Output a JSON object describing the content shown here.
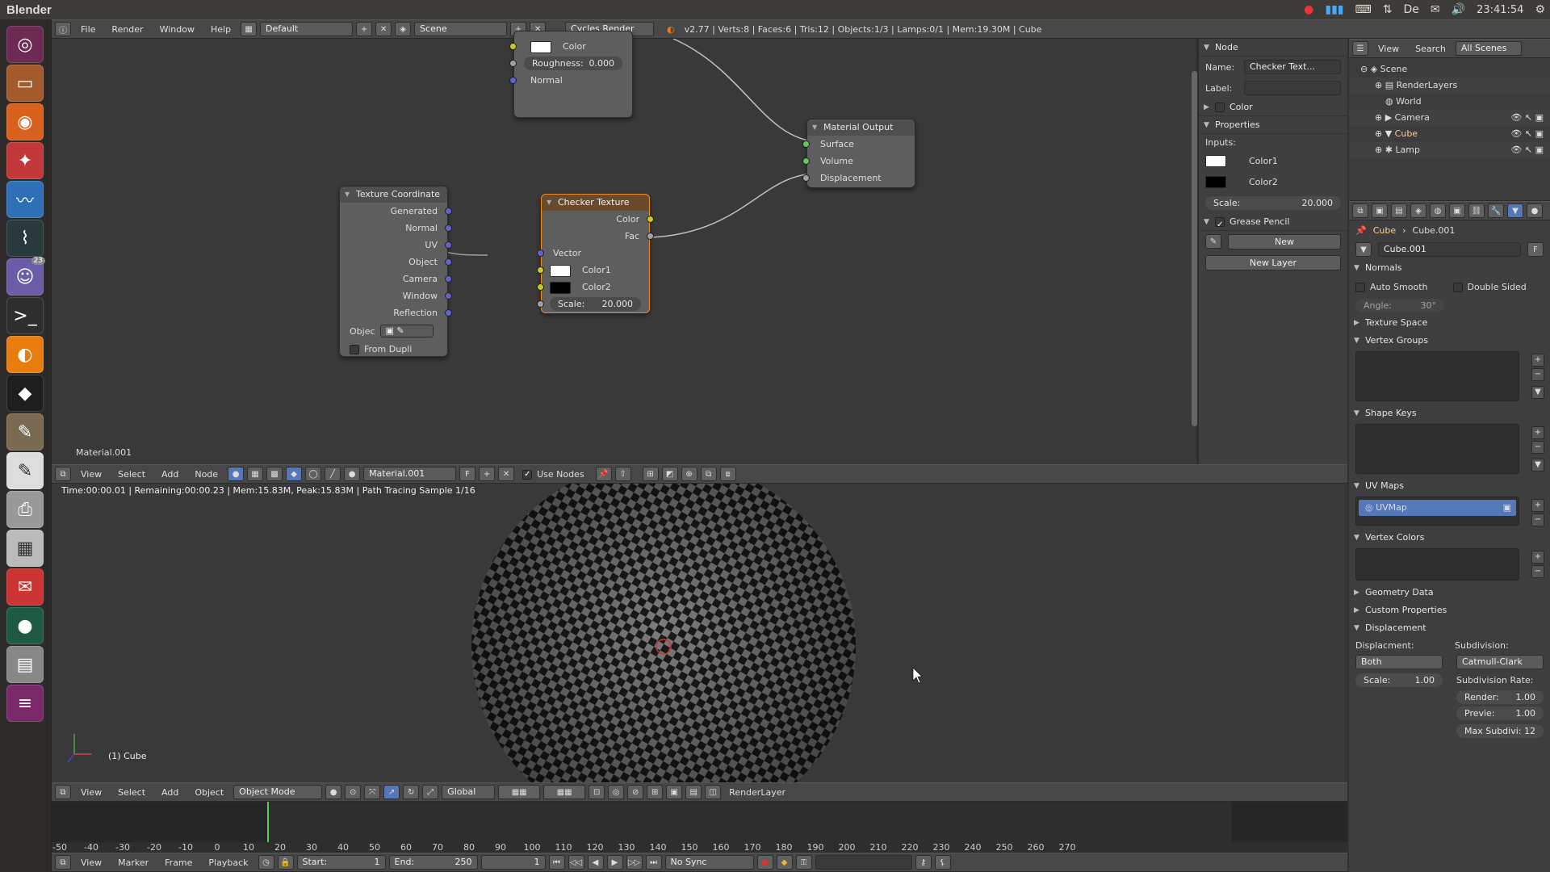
{
  "topbar": {
    "app_title": "Blender",
    "time": "23:41:54"
  },
  "launcher": {
    "badge": "23"
  },
  "info_header": {
    "menus": [
      "File",
      "Render",
      "Window",
      "Help"
    ],
    "screen_layout": "Default",
    "scene": "Scene",
    "engine": "Cycles Render",
    "stats": "v2.77 | Verts:8 | Faces:6 | Tris:12 | Objects:1/3 | Lamps:0/1 | Mem:19.30M | Cube"
  },
  "node_editor": {
    "label": "Material.001",
    "bsdf_partial": {
      "color_label": "Color",
      "roughness_label": "Roughness:",
      "roughness_value": "0.000",
      "normal_label": "Normal"
    },
    "texcoord": {
      "title": "Texture Coordinate",
      "outputs": [
        "Generated",
        "Normal",
        "UV",
        "Object",
        "Camera",
        "Window",
        "Reflection"
      ],
      "object_label": "Objec",
      "from_dupli": "From Dupli"
    },
    "checker": {
      "title": "Checker Texture",
      "out_color": "Color",
      "out_fac": "Fac",
      "vector": "Vector",
      "color1": "Color1",
      "color2": "Color2",
      "scale_label": "Scale:",
      "scale_value": "20.000"
    },
    "output": {
      "title": "Material Output",
      "surface": "Surface",
      "volume": "Volume",
      "displacement": "Displacement"
    }
  },
  "npanel": {
    "node_section": "Node",
    "name_label": "Name:",
    "name_value": "Checker Text...",
    "label_label": "Label:",
    "color_section": "Color",
    "properties_section": "Properties",
    "inputs_label": "Inputs:",
    "color1": "Color1",
    "color2": "Color2",
    "scale_label": "Scale:",
    "scale_value": "20.000",
    "grease_pencil": "Grease Pencil",
    "new_btn": "New",
    "new_layer_btn": "New Layer"
  },
  "node_header": {
    "menus": [
      "View",
      "Select",
      "Add",
      "Node"
    ],
    "material": "Material.001",
    "f_label": "F",
    "use_nodes": "Use Nodes"
  },
  "viewport": {
    "info": "Time:00:00.01 | Remaining:00:00.23 | Mem:15.83M, Peak:15.83M | Path Tracing Sample 1/16",
    "object_label": "(1) Cube"
  },
  "view3d_header": {
    "menus": [
      "View",
      "Select",
      "Add",
      "Object"
    ],
    "mode": "Object Mode",
    "orientation": "Global",
    "render_layer": "RenderLayer"
  },
  "outliner": {
    "menus": [
      "View",
      "Search"
    ],
    "filter": "All Scenes",
    "items": [
      "Scene",
      "RenderLayers",
      "World",
      "Camera",
      "Cube",
      "Lamp"
    ]
  },
  "properties": {
    "breadcrumb_obj": "Cube",
    "breadcrumb_mesh": "Cube.001",
    "mesh_name": "Cube.001",
    "f_label": "F",
    "normals": "Normals",
    "auto_smooth": "Auto Smooth",
    "double_sided": "Double Sided",
    "angle_label": "Angle:",
    "angle_value": "30°",
    "texture_space": "Texture Space",
    "vertex_groups": "Vertex Groups",
    "shape_keys": "Shape Keys",
    "uv_maps": "UV Maps",
    "uvmap_item": "UVMap",
    "vertex_colors": "Vertex Colors",
    "geometry_data": "Geometry Data",
    "custom_properties": "Custom Properties",
    "displacement": "Displacement",
    "displacement_label": "Displacment:",
    "displacement_value": "Both",
    "subdivision_label": "Subdivision:",
    "subdivision_value": "Catmull-Clark",
    "subdiv_rate_label": "Subdivision Rate:",
    "scale_label": "Scale:",
    "scale_value": "1.00",
    "render_label": "Render:",
    "render_value": "1.00",
    "preview_label": "Previe:",
    "preview_value": "1.00",
    "max_subdiv_label": "Max Subdivi:",
    "max_subdiv_value": "12"
  },
  "timeline": {
    "ticks": [
      "-50",
      "-40",
      "-30",
      "-20",
      "-10",
      "0",
      "10",
      "20",
      "30",
      "40",
      "50",
      "60",
      "70",
      "80",
      "90",
      "100",
      "110",
      "120",
      "130",
      "140",
      "150",
      "160",
      "170",
      "180",
      "190",
      "200",
      "210",
      "220",
      "230",
      "240",
      "250",
      "260",
      "270"
    ]
  },
  "timeline_header": {
    "menus": [
      "View",
      "Marker",
      "Frame",
      "Playback"
    ],
    "start_label": "Start:",
    "start_value": "1",
    "end_label": "End:",
    "end_value": "250",
    "current": "1",
    "sync": "No Sync"
  }
}
